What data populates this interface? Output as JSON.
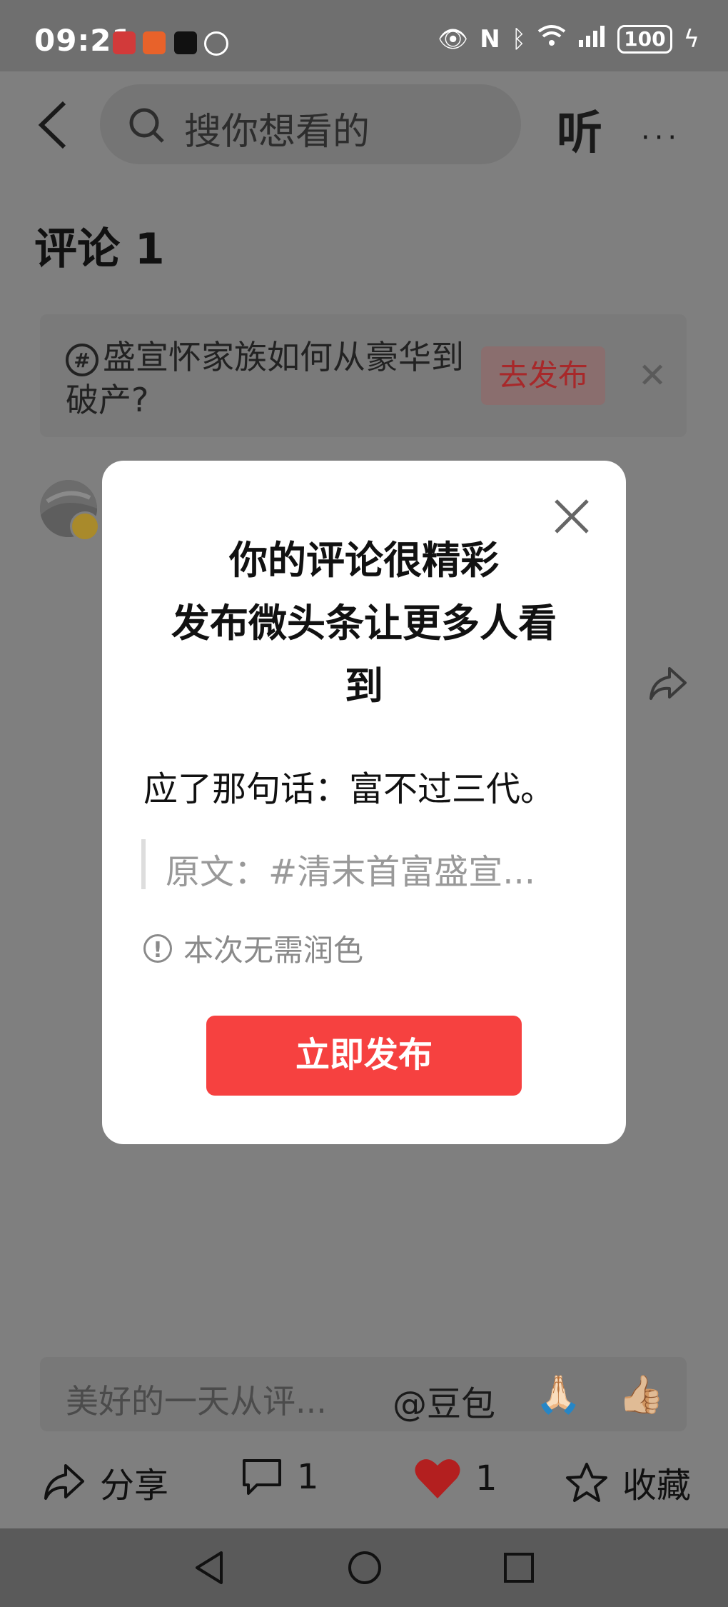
{
  "status_bar": {
    "time": "09:21",
    "battery": "100"
  },
  "header": {
    "search_placeholder": "搜你想看的",
    "listen_label": "听",
    "more_label": "···"
  },
  "comments": {
    "title": "评论 1"
  },
  "topic_banner": {
    "text": "盛宣怀家族如何从豪华到破产?",
    "publish_label": "去发布",
    "close_label": "✕"
  },
  "dialog": {
    "title_line1": "你的评论很精彩",
    "title_line2": "发布微头条让更多人看",
    "title_line3": "到",
    "comment_text": "应了那句话：富不过三代。",
    "quote_text": "原文：#清末首富盛宣...",
    "note_text": "本次无需润色",
    "publish_button": "立即发布"
  },
  "comment_bar": {
    "placeholder": "美好的一天从评...",
    "mention": "@豆包",
    "emoji1": "🙏🏻",
    "emoji2": "👍🏼"
  },
  "actions": {
    "share_label": "分享",
    "comment_count": "1",
    "like_count": "1",
    "favorite_label": "收藏"
  }
}
